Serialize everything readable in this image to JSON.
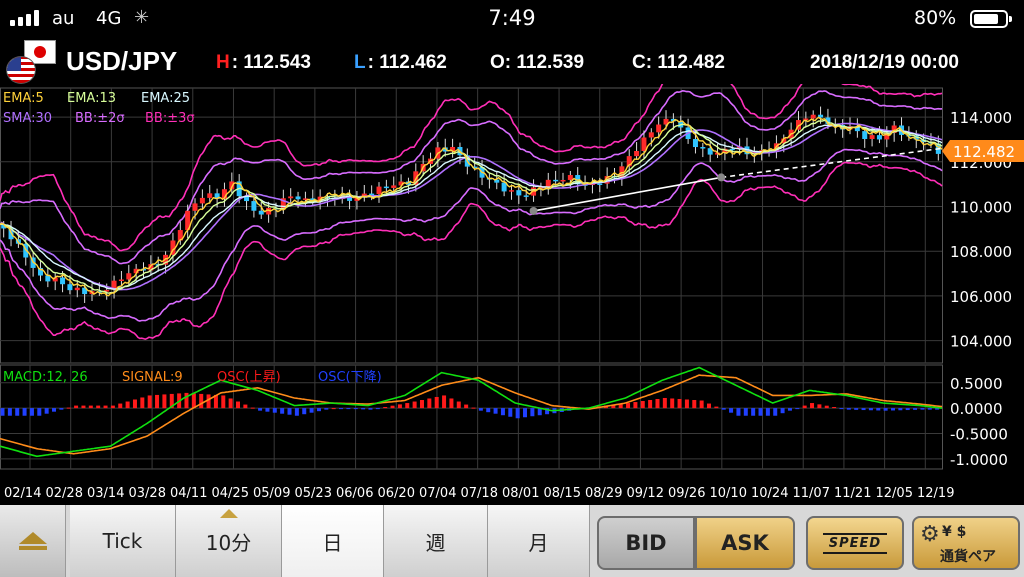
{
  "status_bar": {
    "carrier": "au",
    "network": "4G",
    "time": "7:49",
    "battery_percent": "80%",
    "battery_level": 0.8,
    "signal_bars": 4
  },
  "quote": {
    "pair": "USD/JPY",
    "high_label": "H",
    "high": ": 112.543",
    "low_label": "L",
    "low": ": 112.462",
    "open": "O: 112.539",
    "close": "C: 112.482",
    "datetime": "2018/12/19 00:00",
    "high_color": "#ff2020",
    "low_color": "#3aa0ff"
  },
  "indicators": {
    "ema5": "EMA:5",
    "ema13": "EMA:13",
    "ema25": "EMA:25",
    "sma30": "SMA:30",
    "bb2": "BB:±2σ",
    "bb3": "BB:±3σ",
    "colors": {
      "ema5": "#ffd23a",
      "ema13": "#d8ff9a",
      "ema25": "#d8f8ff",
      "sma30": "#b070ff",
      "bb2": "#d86cff",
      "bb3": "#ff2fb8"
    }
  },
  "macd_legend": {
    "macd": "MACD:12, 26",
    "signal": "SIGNAL:9",
    "osc_up": "OSC(上昇)",
    "osc_down": "OSC(下降)",
    "colors": {
      "macd": "#10e010",
      "signal": "#ff8c1a",
      "osc_up": "#ff1a1a",
      "osc_down": "#2040ff"
    }
  },
  "chart_data": {
    "type": "candlestick",
    "price_axis": {
      "ticks": [
        104,
        106,
        108,
        110,
        112,
        114
      ],
      "tick_labels": [
        "104.000",
        "106.000",
        "108.000",
        "110.000",
        "112.000",
        "114.000"
      ],
      "range": [
        103.0,
        115.3
      ]
    },
    "current_price": "112.482",
    "current_price_value": 112.482,
    "current_price_color": "#ff8a1a",
    "macd_axis": {
      "ticks": [
        0.5,
        0,
        -0.5,
        -1.0
      ],
      "tick_labels": [
        "0.5000",
        "0.0000",
        "-0.5000",
        "-1.0000"
      ],
      "range": [
        -1.2,
        0.85
      ]
    },
    "x_labels": [
      "02/14",
      "02/28",
      "03/14",
      "03/28",
      "04/11",
      "04/25",
      "05/09",
      "05/23",
      "06/06",
      "06/20",
      "07/04",
      "07/18",
      "08/01",
      "08/15",
      "08/29",
      "09/12",
      "09/26",
      "10/10",
      "10/24",
      "11/07",
      "11/21",
      "12/05",
      "12/19"
    ],
    "price_path": [
      [
        0,
        109.2
      ],
      [
        8,
        108.5
      ],
      [
        16,
        107.6
      ],
      [
        24,
        106.8
      ],
      [
        32,
        106.9
      ],
      [
        40,
        106.5
      ],
      [
        48,
        106.2
      ],
      [
        56,
        106.0
      ],
      [
        64,
        106.4
      ],
      [
        72,
        107.0
      ],
      [
        80,
        107.4
      ],
      [
        88,
        107.6
      ],
      [
        96,
        108.4
      ],
      [
        104,
        109.6
      ],
      [
        112,
        110.3
      ],
      [
        120,
        110.4
      ],
      [
        128,
        111.2
      ],
      [
        136,
        110.3
      ],
      [
        144,
        109.7
      ],
      [
        152,
        109.9
      ],
      [
        160,
        110.3
      ],
      [
        168,
        110.2
      ],
      [
        176,
        110.5
      ],
      [
        184,
        110.6
      ],
      [
        192,
        110.4
      ],
      [
        200,
        110.4
      ],
      [
        208,
        110.6
      ],
      [
        216,
        110.9
      ],
      [
        224,
        111.2
      ],
      [
        232,
        112.1
      ],
      [
        240,
        112.6
      ],
      [
        248,
        112.5
      ],
      [
        256,
        111.7
      ],
      [
        264,
        111.3
      ],
      [
        272,
        111.1
      ],
      [
        280,
        110.8
      ],
      [
        288,
        110.6
      ],
      [
        296,
        110.9
      ],
      [
        304,
        111.0
      ],
      [
        312,
        111.2
      ],
      [
        320,
        111.0
      ],
      [
        328,
        111.3
      ],
      [
        336,
        111.5
      ],
      [
        344,
        112.1
      ],
      [
        352,
        112.8
      ],
      [
        360,
        113.6
      ],
      [
        368,
        114.0
      ],
      [
        376,
        113.2
      ],
      [
        384,
        112.6
      ],
      [
        392,
        112.3
      ],
      [
        400,
        112.5
      ],
      [
        408,
        112.3
      ],
      [
        416,
        112.5
      ],
      [
        424,
        112.9
      ],
      [
        432,
        113.6
      ],
      [
        440,
        114.0
      ],
      [
        448,
        113.8
      ],
      [
        456,
        113.4
      ],
      [
        464,
        113.6
      ],
      [
        472,
        113.3
      ],
      [
        480,
        113.2
      ],
      [
        488,
        113.5
      ],
      [
        496,
        112.9
      ],
      [
        504,
        112.8
      ],
      [
        512,
        112.5
      ]
    ],
    "trendline": {
      "from": [
        290,
        109.8
      ],
      "to": [
        392,
        111.3
      ],
      "extend_to": [
        512,
        112.6
      ]
    },
    "macd_path": [
      [
        0,
        -0.75
      ],
      [
        20,
        -0.95
      ],
      [
        40,
        -0.85
      ],
      [
        60,
        -0.75
      ],
      [
        80,
        -0.3
      ],
      [
        100,
        0.2
      ],
      [
        120,
        0.55
      ],
      [
        140,
        0.35
      ],
      [
        160,
        0.05
      ],
      [
        180,
        0.1
      ],
      [
        200,
        0.05
      ],
      [
        220,
        0.25
      ],
      [
        240,
        0.7
      ],
      [
        260,
        0.55
      ],
      [
        280,
        0.1
      ],
      [
        300,
        -0.05
      ],
      [
        320,
        0.0
      ],
      [
        340,
        0.2
      ],
      [
        360,
        0.55
      ],
      [
        380,
        0.8
      ],
      [
        400,
        0.45
      ],
      [
        420,
        0.1
      ],
      [
        440,
        0.35
      ],
      [
        460,
        0.25
      ],
      [
        480,
        0.1
      ],
      [
        500,
        0.05
      ],
      [
        512,
        0.0
      ]
    ],
    "signal_path": [
      [
        0,
        -0.6
      ],
      [
        20,
        -0.8
      ],
      [
        40,
        -0.9
      ],
      [
        60,
        -0.8
      ],
      [
        80,
        -0.55
      ],
      [
        100,
        -0.1
      ],
      [
        120,
        0.3
      ],
      [
        140,
        0.4
      ],
      [
        160,
        0.2
      ],
      [
        180,
        0.1
      ],
      [
        200,
        0.08
      ],
      [
        220,
        0.15
      ],
      [
        240,
        0.45
      ],
      [
        260,
        0.6
      ],
      [
        280,
        0.3
      ],
      [
        300,
        0.05
      ],
      [
        320,
        -0.02
      ],
      [
        340,
        0.1
      ],
      [
        360,
        0.35
      ],
      [
        380,
        0.65
      ],
      [
        400,
        0.6
      ],
      [
        420,
        0.25
      ],
      [
        440,
        0.25
      ],
      [
        460,
        0.28
      ],
      [
        480,
        0.15
      ],
      [
        500,
        0.08
      ],
      [
        512,
        0.03
      ]
    ]
  },
  "tabs": {
    "tick": "Tick",
    "min10": "10分",
    "day": "日",
    "week": "週",
    "month": "月",
    "bid": "BID",
    "ask": "ASK",
    "speed": "SPEED",
    "pair_select": "通貨ペア",
    "pair_coins": "¥ $"
  }
}
